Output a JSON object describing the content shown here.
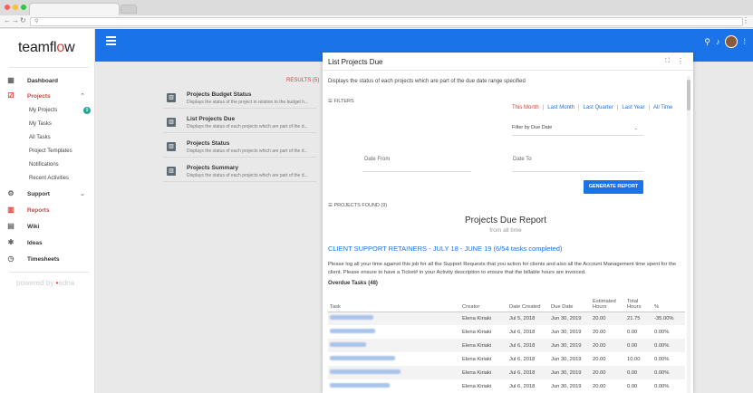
{
  "browser": {
    "dots": [
      "#ff5f56",
      "#ffbd2e",
      "#27c93f"
    ],
    "url_icon": "search-icon"
  },
  "sidebar": {
    "logo": {
      "pre": "teamfl",
      "o": "o",
      "post": "w"
    },
    "items": [
      {
        "label": "Dashboard",
        "icon": "dashboard-icon"
      },
      {
        "label": "Projects",
        "icon": "projects-icon",
        "active": true
      },
      {
        "label": "Support",
        "icon": "support-icon"
      },
      {
        "label": "Reports",
        "icon": "reports-icon",
        "active": true
      },
      {
        "label": "Wiki",
        "icon": "wiki-icon"
      },
      {
        "label": "Ideas",
        "icon": "ideas-icon"
      },
      {
        "label": "Timesheets",
        "icon": "timesheets-icon"
      }
    ],
    "project_sub": [
      "My Projects",
      "My Tasks",
      "All Tasks",
      "Project Templates",
      "Notifications",
      "Recent Activities"
    ],
    "my_projects_badge": "9",
    "powered_by": "powered by",
    "powered_brand_pre": "",
    "powered_brand_dot": "•",
    "powered_brand": "edna"
  },
  "reports": {
    "results": "RESULTS (5)",
    "items": [
      {
        "title": "Projects Budget Status",
        "desc": "Displays the status of the project in relation to the budget h..."
      },
      {
        "title": "List Projects Due",
        "desc": "Displays the status of each projects which are part of the d..."
      },
      {
        "title": "Projects Status",
        "desc": "Displays the status of each projects which are part of the d..."
      },
      {
        "title": "Projects Summary",
        "desc": "Displays the status of each projects which are part of the d..."
      }
    ]
  },
  "modal": {
    "title": "List Projects Due",
    "description": "Displays the status of each projects which are part of the due date range specified",
    "filters_label": "FILTERS",
    "periods": [
      "This Month",
      "Last Month",
      "Last Quarter",
      "Last Year",
      "All Time"
    ],
    "filter_by": "Filter by Due Date",
    "date_from": "Date From",
    "date_to": "Date To",
    "generate": "GENERATE REPORT",
    "found": "PROJECTS FOUND (9)",
    "report_title": "Projects Due Report",
    "report_subtitle": "from all time",
    "client_heading": "CLIENT SUPPORT RETAINERS - JULY 18 - JUNE 19 (6/54 tasks completed)",
    "paragraph": "Please log all your time against this job for all the Support Requests that you action for clients and also all the Account Management time spent for the client. Please ensure to have a Ticket# in your Activity description to ensure that the billable hours are invoiced.",
    "overdue": "Overdue Tasks (48)",
    "columns": [
      "Task",
      "Creator",
      "Date Created",
      "Due Date",
      "Estimated Hours",
      "Total Hours",
      "%"
    ],
    "rows": [
      {
        "task": "",
        "creator": "Elena Kiriaki",
        "created": "Jul 5, 2018",
        "due": "Jun 30, 2019",
        "est": "20.00",
        "total": "21.75",
        "pct": "-35.00%"
      },
      {
        "task": "",
        "creator": "Elena Kiriaki",
        "created": "Jul 6, 2018",
        "due": "Jun 30, 2019",
        "est": "20.00",
        "total": "0.00",
        "pct": "0.00%"
      },
      {
        "task": "",
        "creator": "Elena Kiriaki",
        "created": "Jul 6, 2018",
        "due": "Jun 30, 2019",
        "est": "20.00",
        "total": "0.00",
        "pct": "0.00%"
      },
      {
        "task": "",
        "creator": "Elena Kiriaki",
        "created": "Jul 6, 2018",
        "due": "Jun 30, 2019",
        "est": "20.00",
        "total": "10.00",
        "pct": "0.00%"
      },
      {
        "task": "",
        "creator": "Elena Kiriaki",
        "created": "Jul 6, 2018",
        "due": "Jun 30, 2019",
        "est": "20.00",
        "total": "0.00",
        "pct": "0.00%"
      },
      {
        "task": "",
        "creator": "Elena Kiriaki",
        "created": "Jul 6, 2018",
        "due": "Jun 30, 2019",
        "est": "20.00",
        "total": "0.00",
        "pct": "0.00%"
      }
    ]
  },
  "colors": {
    "brand_blue": "#1a73e8",
    "accent_red": "#e53935"
  }
}
